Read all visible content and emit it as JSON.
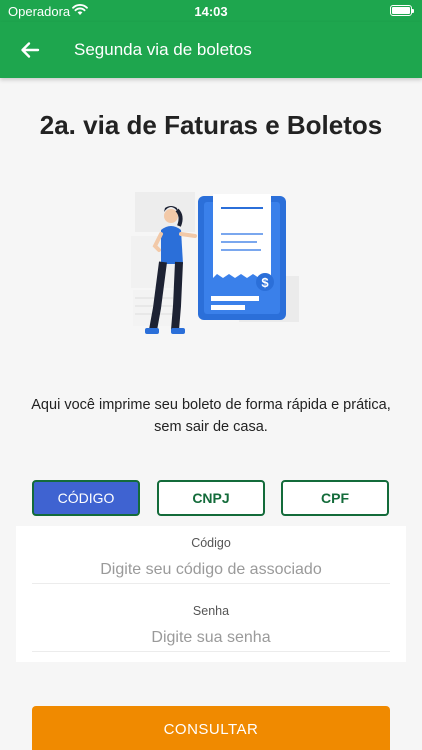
{
  "status_bar": {
    "carrier": "Operadora",
    "time": "14:03"
  },
  "app_bar": {
    "title": "Segunda via de boletos"
  },
  "page": {
    "heading": "2a. via de Faturas e Boletos",
    "description": "Aqui você imprime seu boleto de forma rápida e prática, sem sair de casa."
  },
  "tabs": [
    {
      "label": "CÓDIGO",
      "active": true
    },
    {
      "label": "CNPJ",
      "active": false
    },
    {
      "label": "CPF",
      "active": false
    }
  ],
  "form": {
    "code_label": "Código",
    "code_placeholder": "Digite seu código de associado",
    "password_label": "Senha",
    "password_placeholder": "Digite sua senha"
  },
  "actions": {
    "submit_label": "CONSULTAR"
  },
  "colors": {
    "primary": "#1ea64e",
    "tab_active": "#3f63d1",
    "tab_border": "#136b3a",
    "accent": "#f08a00"
  }
}
